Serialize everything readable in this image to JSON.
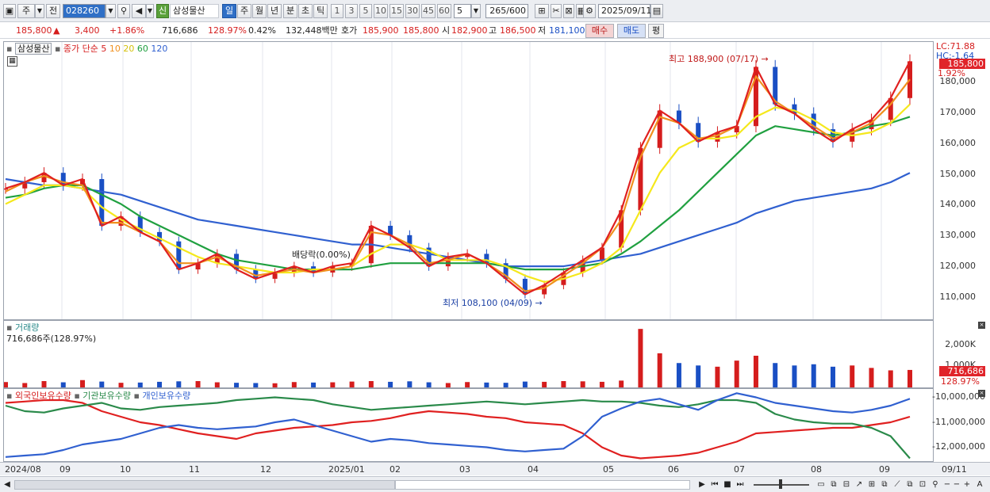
{
  "toolbar": {
    "market": "주",
    "prev": "전",
    "code": "028260",
    "badge_new": "신",
    "stock_name": "삼성물산",
    "periods": [
      "일",
      "주",
      "월",
      "년",
      "분",
      "초",
      "틱"
    ],
    "active_period": "일",
    "intervals": [
      "1",
      "3",
      "5",
      "10",
      "15",
      "30",
      "45",
      "60"
    ],
    "custom_interval": "5",
    "count": "265",
    "total": "/600",
    "date": "2025/09/11"
  },
  "quote": {
    "price": "185,800",
    "change_arrow": "▲",
    "change": "3,400",
    "change_pct": "+1.86%",
    "volume": "716,686",
    "volume_ratio": "128.97%",
    "turnover_pct": "0.42%",
    "amount": "132,448백만",
    "ask_label": "호가",
    "ask1": "185,900",
    "ask2": "185,800",
    "open_label": "시",
    "open": "182,900",
    "high_label": "고",
    "high": "186,500",
    "low_label": "저",
    "low": "181,100",
    "buy_button": "매수",
    "sell_button": "매도",
    "eval_button": "평"
  },
  "price_panel": {
    "title": "삼성물산",
    "ma_label": "종가 단순",
    "ma_periods": [
      "5",
      "10",
      "20",
      "60",
      "120"
    ],
    "ma_colors": [
      "#e02020",
      "#f0901e",
      "#f5e81c",
      "#20a040",
      "#3060d0"
    ],
    "lc": "LC:71.88",
    "hc": "HC:-1.64",
    "last_price": "185,800",
    "last_pct": "1.92%",
    "y_ticks": [
      "180,000",
      "170,000",
      "160,000",
      "150,000",
      "140,000",
      "130,000",
      "120,000",
      "110,000"
    ],
    "high_annotation": "최고 188,900 (07/17)",
    "low_annotation": "최저 108,100 (04/09)",
    "dividend_annotation": "배당락(0.00%)"
  },
  "volume_panel": {
    "title": "거래량",
    "value": "716,686주(128.97%)",
    "y_ticks": [
      "2,000K",
      "1,000K"
    ],
    "last_value": "716,686",
    "last_pct": "128.97%"
  },
  "holding_panel": {
    "legend": [
      "외국인보유수량",
      "기관보유수량",
      "개인보유수량"
    ],
    "colors": [
      "#e02020",
      "#2a8a4a",
      "#3060d0"
    ],
    "y_ticks": [
      "-10,000,000",
      "-11,000,000",
      "-12,000,000"
    ]
  },
  "date_axis": {
    "labels": [
      "2024/08",
      "09",
      "10",
      "11",
      "12",
      "2025/01",
      "02",
      "03",
      "04",
      "05",
      "06",
      "07",
      "08",
      "09"
    ],
    "right_label": "09/11"
  },
  "chart_data": {
    "type": "line",
    "price_range": [
      103000,
      192000
    ],
    "price_points": [
      145000,
      147000,
      150000,
      146000,
      148000,
      133000,
      136000,
      131000,
      128000,
      119000,
      121000,
      124000,
      119000,
      116000,
      118000,
      120000,
      118000,
      120000,
      121000,
      133000,
      130000,
      126000,
      120000,
      123000,
      124000,
      121000,
      116000,
      111000,
      114000,
      118000,
      122000,
      126000,
      138000,
      158000,
      170000,
      166000,
      160000,
      163000,
      165000,
      184000,
      172000,
      169000,
      164000,
      160000,
      164000,
      167000,
      174000,
      185800
    ],
    "ma5_points": [
      144000,
      147000,
      149000,
      147000,
      146000,
      134000,
      134000,
      131000,
      128000,
      121000,
      121000,
      123000,
      120000,
      117000,
      118000,
      119000,
      118000,
      119000,
      120000,
      131000,
      130000,
      127000,
      121000,
      122000,
      124000,
      121000,
      117000,
      112000,
      113000,
      117000,
      121000,
      126000,
      135000,
      155000,
      168000,
      166000,
      161000,
      162000,
      165000,
      181000,
      173000,
      169000,
      165000,
      161000,
      163000,
      166000,
      172000,
      180000
    ],
    "ma20_points": [
      140000,
      143000,
      146000,
      146000,
      145000,
      139000,
      135000,
      132000,
      129000,
      126000,
      123000,
      121000,
      120000,
      119000,
      118000,
      118000,
      119000,
      119000,
      120000,
      124000,
      127000,
      127000,
      125000,
      122000,
      122000,
      122000,
      120000,
      117000,
      115000,
      116000,
      118000,
      121000,
      126000,
      138000,
      150000,
      158000,
      161000,
      161000,
      162000,
      168000,
      171000,
      170000,
      167000,
      163000,
      162000,
      163000,
      166000,
      172000
    ],
    "ma60_points": [
      142000,
      143000,
      145000,
      146000,
      146000,
      143000,
      140000,
      136000,
      133000,
      130000,
      127000,
      124000,
      122000,
      121000,
      120000,
      119000,
      119000,
      119000,
      119000,
      120000,
      121000,
      121000,
      121000,
      121000,
      121000,
      121000,
      120000,
      119000,
      119000,
      119000,
      120000,
      121000,
      124000,
      128000,
      133000,
      138000,
      144000,
      150000,
      156000,
      162000,
      165000,
      164000,
      163000,
      162000,
      163000,
      165000,
      166000,
      168000
    ],
    "ma120_points": [
      148000,
      147000,
      146000,
      146000,
      145000,
      144000,
      143000,
      141000,
      139000,
      137000,
      135000,
      134000,
      133000,
      132000,
      131000,
      130000,
      129000,
      128000,
      127000,
      127000,
      126000,
      125000,
      124000,
      123000,
      122000,
      121000,
      120000,
      120000,
      120000,
      120000,
      121000,
      122000,
      123000,
      124000,
      126000,
      128000,
      130000,
      132000,
      134000,
      137000,
      139000,
      141000,
      142000,
      143000,
      144000,
      145000,
      147000,
      150000
    ],
    "volume_k": [
      220,
      180,
      260,
      210,
      300,
      240,
      190,
      200,
      230,
      250,
      260,
      210,
      190,
      180,
      170,
      220,
      200,
      210,
      240,
      260,
      230,
      250,
      210,
      180,
      220,
      200,
      190,
      240,
      230,
      260,
      250,
      230,
      280,
      2400,
      1400,
      1000,
      900,
      850,
      1100,
      1300,
      1000,
      900,
      950,
      850,
      900,
      800,
      700,
      717
    ],
    "foreign_holding": [
      -10400000,
      -10350000,
      -10300000,
      -10300000,
      -10400000,
      -10700000,
      -10900000,
      -11100000,
      -11200000,
      -11350000,
      -11500000,
      -11600000,
      -11700000,
      -11500000,
      -11400000,
      -11300000,
      -11250000,
      -11200000,
      -11100000,
      -11050000,
      -10950000,
      -10800000,
      -10700000,
      -10750000,
      -10800000,
      -10900000,
      -10950000,
      -11100000,
      -11150000,
      -11200000,
      -11500000,
      -12000000,
      -12300000,
      -12400000,
      -12350000,
      -12300000,
      -12200000,
      -12000000,
      -11800000,
      -11500000,
      -11450000,
      -11400000,
      -11350000,
      -11300000,
      -11300000,
      -11200000,
      -11100000,
      -10900000
    ],
    "institution_holding": [
      -10500000,
      -10700000,
      -10750000,
      -10600000,
      -10500000,
      -10400000,
      -10600000,
      -10650000,
      -10550000,
      -10500000,
      -10450000,
      -10400000,
      -10300000,
      -10250000,
      -10200000,
      -10250000,
      -10300000,
      -10450000,
      -10550000,
      -10650000,
      -10600000,
      -10550000,
      -10500000,
      -10450000,
      -10400000,
      -10350000,
      -10400000,
      -10450000,
      -10400000,
      -10350000,
      -10300000,
      -10350000,
      -10350000,
      -10400000,
      -10500000,
      -10550000,
      -10450000,
      -10300000,
      -10300000,
      -10400000,
      -10800000,
      -11000000,
      -11100000,
      -11150000,
      -11150000,
      -11300000,
      -11600000,
      -12400000
    ],
    "individual_holding": [
      -12350000,
      -12300000,
      -12250000,
      -12100000,
      -11900000,
      -11800000,
      -11700000,
      -11500000,
      -11300000,
      -11200000,
      -11300000,
      -11350000,
      -11300000,
      -11250000,
      -11100000,
      -11000000,
      -11200000,
      -11400000,
      -11600000,
      -11800000,
      -11700000,
      -11750000,
      -11850000,
      -11900000,
      -11950000,
      -12000000,
      -12100000,
      -12150000,
      -12100000,
      -12050000,
      -11600000,
      -10900000,
      -10600000,
      -10350000,
      -10250000,
      -10450000,
      -10650000,
      -10300000,
      -10050000,
      -10200000,
      -10400000,
      -10500000,
      -10600000,
      -10700000,
      -10750000,
      -10650000,
      -10500000,
      -10250000
    ]
  }
}
